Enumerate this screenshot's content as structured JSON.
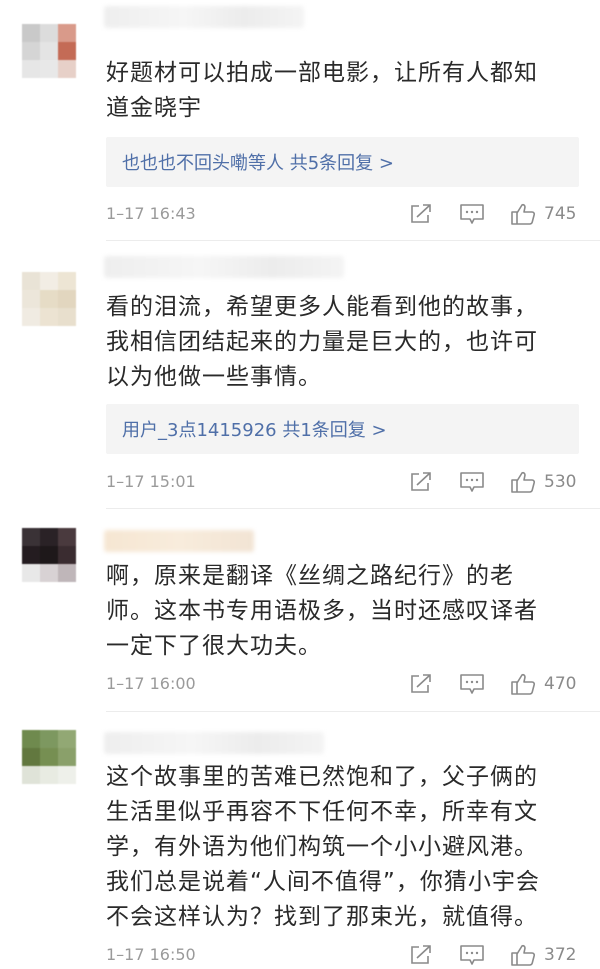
{
  "comments": [
    {
      "text_lines": [
        "好题材可以拍成一部电影，让所有人都知",
        "道金晓宇"
      ],
      "reply": "也也也不回头嘞等人  共5条回复 >",
      "time": "1–17 16:43",
      "likes": "745"
    },
    {
      "text_lines": [
        "看的泪流，希望更多人能看到他的故事，",
        "我相信团结起来的力量是巨大的，也许可",
        "以为他做一些事情。"
      ],
      "reply": "用户_3点1415926  共1条回复 >",
      "time": "1–17 15:01",
      "likes": "530"
    },
    {
      "text_lines": [
        "啊，原来是翻译《丝绸之路纪行》的老",
        "师。这本书专用语极多，当时还感叹译者",
        "一定下了很大功夫。"
      ],
      "time": "1–17 16:00",
      "likes": "470"
    },
    {
      "text_lines": [
        "这个故事里的苦难已然饱和了，父子俩的",
        "生活里似乎再容不下任何不幸，所幸有文",
        "学，有外语为他们构筑一个小小避风港。",
        "我们总是说着“人间不值得”，你猜小宇会",
        "不会这样认为？找到了那束光，就值得。"
      ],
      "time": "1–17 16:50",
      "likes": "372"
    }
  ],
  "colors": {
    "reply_link": "#4f6fa8",
    "meta_gray": "#9a9a9a",
    "reply_bg": "#f4f4f4"
  },
  "icons": [
    "share-icon",
    "comment-icon",
    "like-icon"
  ]
}
